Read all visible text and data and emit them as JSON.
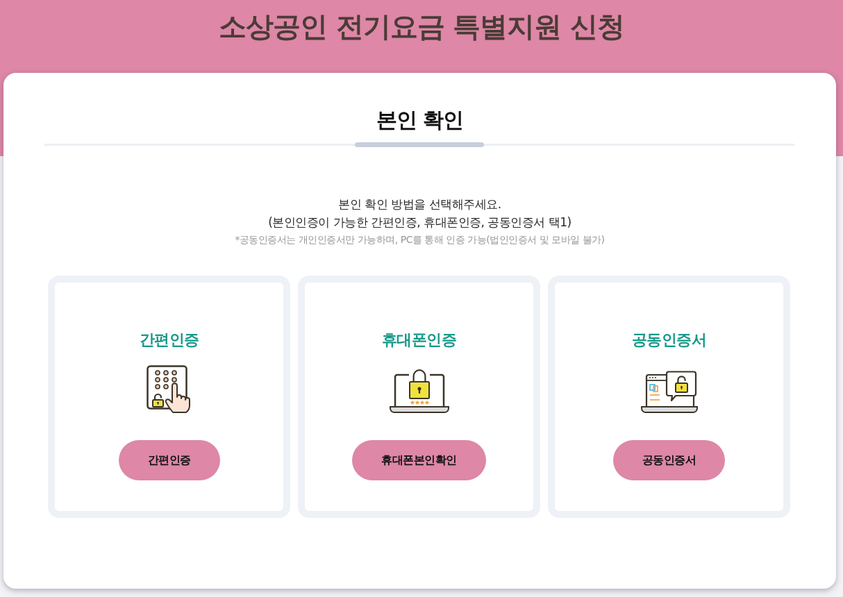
{
  "header": {
    "title": "소상공인 전기요금 특별지원 신청"
  },
  "panel": {
    "heading": "본인 확인",
    "instructions": [
      "본인 확인 방법을 선택해주세요.",
      "(본인인증이 가능한 간편인증, 휴대폰인증, 공동인증서 택1)"
    ],
    "note": "*공동인증서는 개인인증서만 가능하며, PC를 통해 인증 가능(법인인증서 및 모바일 불가)"
  },
  "methods": [
    {
      "kind": "simple",
      "title": "간편인증",
      "button": "간편인증"
    },
    {
      "kind": "phone",
      "title": "휴대폰인증",
      "button": "휴대폰본인확인"
    },
    {
      "kind": "certificate",
      "title": "공동인증서",
      "button": "공동인증서"
    }
  ]
}
